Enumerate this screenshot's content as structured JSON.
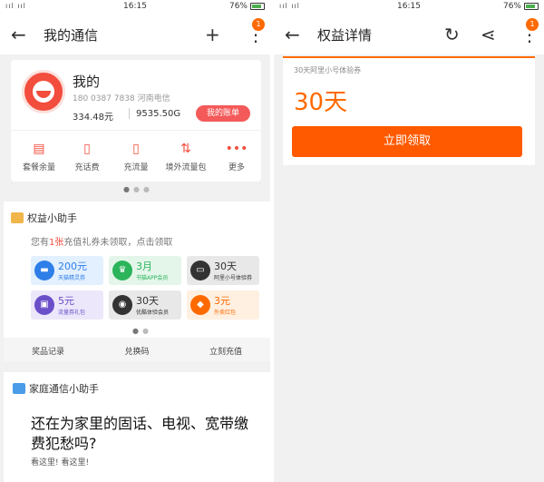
{
  "left": {
    "status": {
      "signal": "ııl ııl",
      "time": "16:15",
      "battery": "76%"
    },
    "appbar": {
      "title": "我的通信",
      "add_icon": "+",
      "more_icon": "⋮",
      "badge": "1",
      "back_icon": "←"
    },
    "account": {
      "name": "我的",
      "phone": "180 0387 7838 河南电信",
      "balance": "334.48元",
      "flow": "9535.50G",
      "bill_button": "我的账单"
    },
    "quick_actions": [
      {
        "icon": "package-icon",
        "glyph": "▤",
        "label": "套餐余量"
      },
      {
        "icon": "phone-topup-icon",
        "glyph": "▯",
        "label": "充话费"
      },
      {
        "icon": "data-topup-icon",
        "glyph": "▯",
        "label": "充流量"
      },
      {
        "icon": "travel-data-icon",
        "glyph": "⇅",
        "label": "境外流量包"
      },
      {
        "icon": "more-icon",
        "glyph": "•••",
        "label": "更多"
      }
    ],
    "assistant": {
      "title": "权益小助手",
      "hint_prefix": "您有",
      "hint_count": "1张",
      "hint_suffix": "充值礼券未领取，点击领取",
      "coupons": [
        {
          "value": "200元",
          "desc": "天猫精灵券",
          "color": "#2f7fe8",
          "bg": "#e3f0ff",
          "icon": "▬"
        },
        {
          "value": "3月",
          "desc": "书猫APP会员",
          "color": "#2bb45a",
          "bg": "#e4f6ea",
          "icon": "♛"
        },
        {
          "value": "30天",
          "desc": "阿里小号体验券",
          "color": "#333333",
          "bg": "#e8e8e8",
          "icon": "▭"
        },
        {
          "value": "5元",
          "desc": "流量券礼包",
          "color": "#6b4fc9",
          "bg": "#ece7fa",
          "icon": "▣"
        },
        {
          "value": "30天",
          "desc": "优酷体验会员",
          "color": "#333333",
          "bg": "#e8e8e8",
          "icon": "◉"
        },
        {
          "value": "3元",
          "desc": "外卖红包",
          "color": "#ff6a00",
          "bg": "#fff0e1",
          "icon": "◆"
        }
      ],
      "links": [
        "奖品记录",
        "兑换码",
        "立刻充值"
      ]
    },
    "family": {
      "title": "家庭通信小助手",
      "headline": "还在为家里的固话、电视、宽带缴费犯愁吗?",
      "sub": "看这里! 看这里!"
    }
  },
  "right": {
    "status": {
      "signal": "ııl ııl",
      "time": "16:15",
      "battery": "76%"
    },
    "appbar": {
      "title": "权益详情",
      "back_icon": "←",
      "refresh_icon": "↻",
      "share_icon": "⋖",
      "more_icon": "⋮",
      "badge": "1"
    },
    "detail": {
      "subtitle": "30天阿里小号体验券",
      "days": "30天",
      "claim_button": "立即领取"
    }
  }
}
